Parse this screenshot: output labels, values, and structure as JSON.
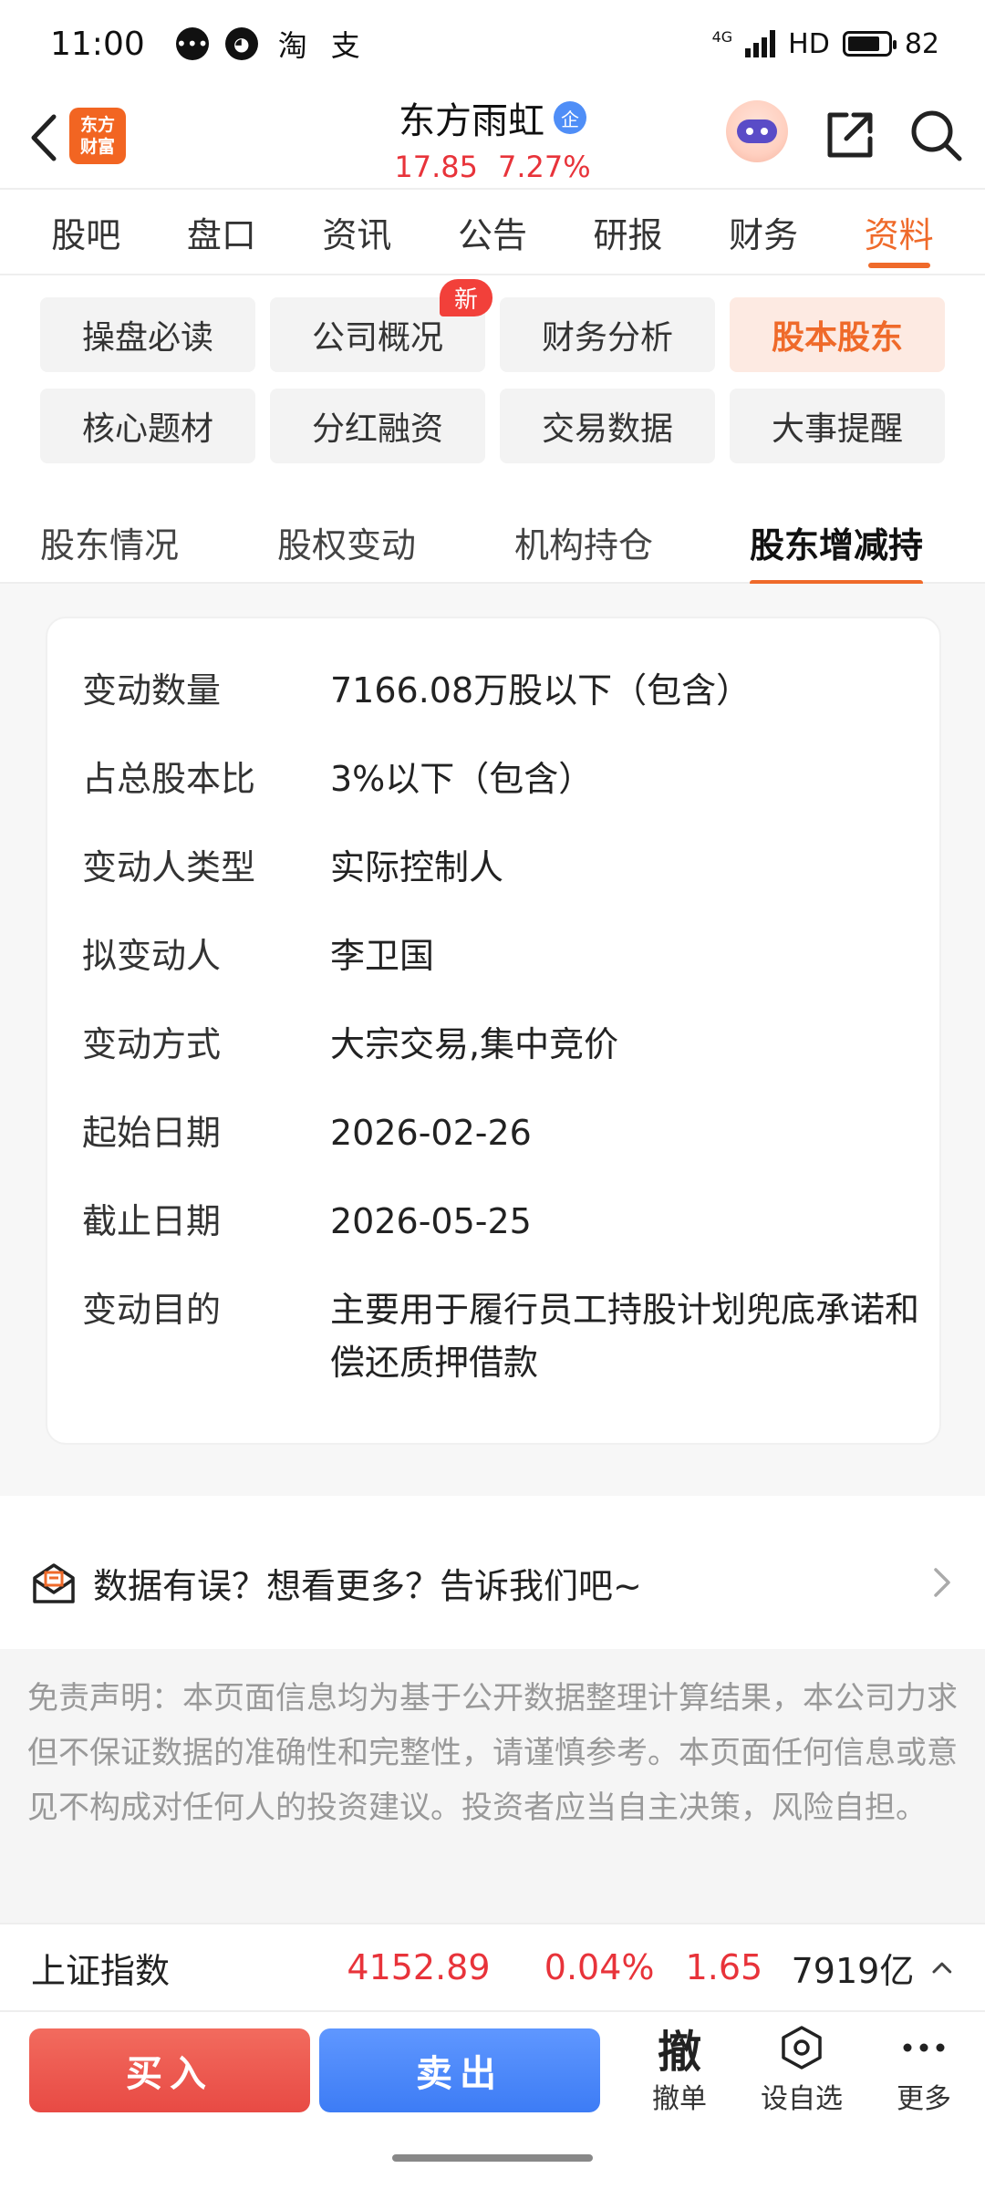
{
  "status": {
    "time": "11:00",
    "app_icons": [
      "message-icon",
      "chat-icon",
      "taobao-icon",
      "alipay-icon"
    ],
    "network": "4G",
    "hd": "HD",
    "battery": "82"
  },
  "header": {
    "logo_text": "东方财富",
    "stock_name": "东方雨虹",
    "enterprise_badge": "企",
    "price": "17.85",
    "change_pct": "7.27%"
  },
  "main_tabs": [
    "股吧",
    "盘口",
    "资讯",
    "公告",
    "研报",
    "财务",
    "资料"
  ],
  "main_tab_active": "资料",
  "sub_nav": {
    "row1": [
      "操盘必读",
      "公司概况",
      "财务分析",
      "股本股东"
    ],
    "row2": [
      "核心题材",
      "分红融资",
      "交易数据",
      "大事提醒"
    ],
    "new_badge": "新",
    "active": "股本股东"
  },
  "secondary_tabs": [
    "股东情况",
    "股权变动",
    "机构持仓",
    "股东增减持"
  ],
  "secondary_active": "股东增减持",
  "detail": {
    "rows": [
      {
        "label": "变动数量",
        "value": "7166.08万股以下（包含）"
      },
      {
        "label": "占总股本比",
        "value": "3%以下（包含）"
      },
      {
        "label": "变动人类型",
        "value": "实际控制人"
      },
      {
        "label": "拟变动人",
        "value": "李卫国"
      },
      {
        "label": "变动方式",
        "value": "大宗交易,集中竞价"
      },
      {
        "label": "起始日期",
        "value": "2026-02-26"
      },
      {
        "label": "截止日期",
        "value": "2026-05-25"
      },
      {
        "label": "变动目的",
        "value": "主要用于履行员工持股计划兜底承诺和偿还质押借款"
      }
    ]
  },
  "feedback": {
    "text": "数据有误？想看更多？告诉我们吧~"
  },
  "disclaimer": "免责声明：本页面信息均为基于公开数据整理计算结果，本公司力求但不保证数据的准确性和完整性，请谨慎参考。本页面任何信息或意见不构成对任何人的投资建议。投资者应当自主决策，风险自担。",
  "index_bar": {
    "name": "上证指数",
    "price": "4152.89",
    "change_pct": "0.04%",
    "change": "1.65",
    "volume": "7919亿"
  },
  "actions": {
    "buy": "买入",
    "sell": "卖出",
    "cancel_glyph": "撤",
    "cancel": "撤单",
    "watchlist": "设自选",
    "more": "更多"
  },
  "colors": {
    "accent": "#ef6a2a",
    "up_red": "#e8333a",
    "buy": "#e84a44",
    "sell": "#3d7cf5"
  }
}
